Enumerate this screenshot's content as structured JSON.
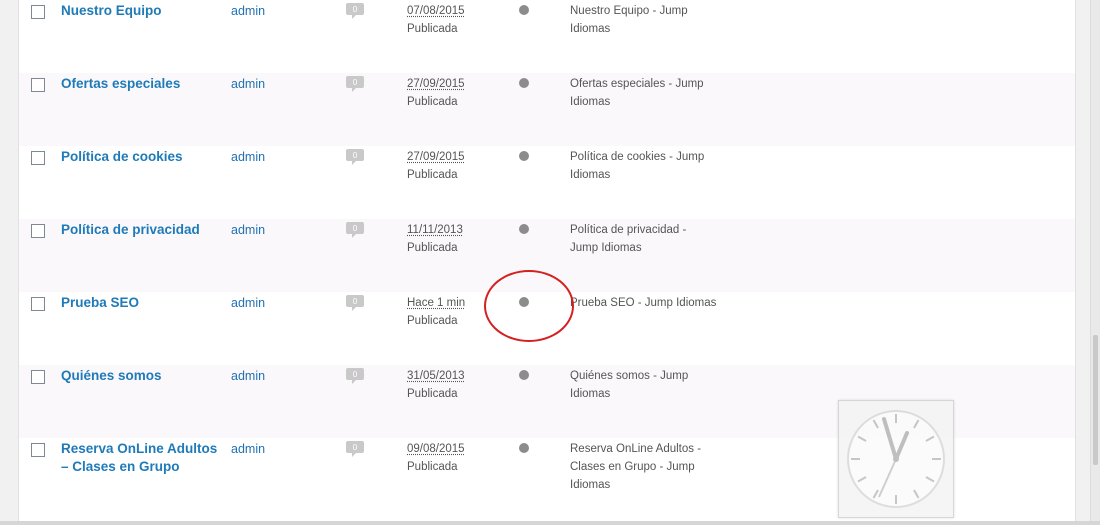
{
  "rows": [
    {
      "title_lines": [
        "Nuestro Equipo"
      ],
      "author": "admin",
      "date": "07/08/2015",
      "status": "Publicada",
      "seo_lines": [
        "Nuestro Equipo - Jump",
        "Idiomas"
      ]
    },
    {
      "title_lines": [
        "Ofertas especiales"
      ],
      "author": "admin",
      "date": "27/09/2015",
      "status": "Publicada",
      "seo_lines": [
        "Ofertas especiales - Jump",
        "Idiomas"
      ]
    },
    {
      "title_lines": [
        "Política de cookies"
      ],
      "author": "admin",
      "date": "27/09/2015",
      "status": "Publicada",
      "seo_lines": [
        "Política de cookies - Jump",
        "Idiomas"
      ]
    },
    {
      "title_lines": [
        "Política de privacidad"
      ],
      "author": "admin",
      "date": "11/11/2013",
      "status": "Publicada",
      "seo_lines": [
        "Política de privacidad -",
        "Jump Idiomas"
      ]
    },
    {
      "title_lines": [
        "Prueba SEO"
      ],
      "author": "admin",
      "date": "Hace 1 min",
      "status": "Publicada",
      "seo_lines": [
        "Prueba SEO - Jump Idiomas"
      ]
    },
    {
      "title_lines": [
        "Quiénes somos"
      ],
      "author": "admin",
      "date": "31/05/2013",
      "status": "Publicada",
      "seo_lines": [
        "Quiénes somos - Jump",
        "Idiomas"
      ]
    },
    {
      "title_lines": [
        "Reserva OnLine Adultos",
        "– Clases en Grupo"
      ],
      "author": "admin",
      "date": "09/08/2015",
      "status": "Publicada",
      "seo_lines": [
        "Reserva OnLine Adultos -",
        "Clases en Grupo - Jump",
        "Idiomas"
      ]
    }
  ],
  "comment_count": "0",
  "colors": {
    "link": "#1e7ab8",
    "seo_dot": "#8c8c8c",
    "annotation": "#d42020"
  },
  "icons": {
    "comment": "comment-bubble-icon",
    "seo_status": "seo-status-dot-icon",
    "overlay": "clock-icon"
  }
}
